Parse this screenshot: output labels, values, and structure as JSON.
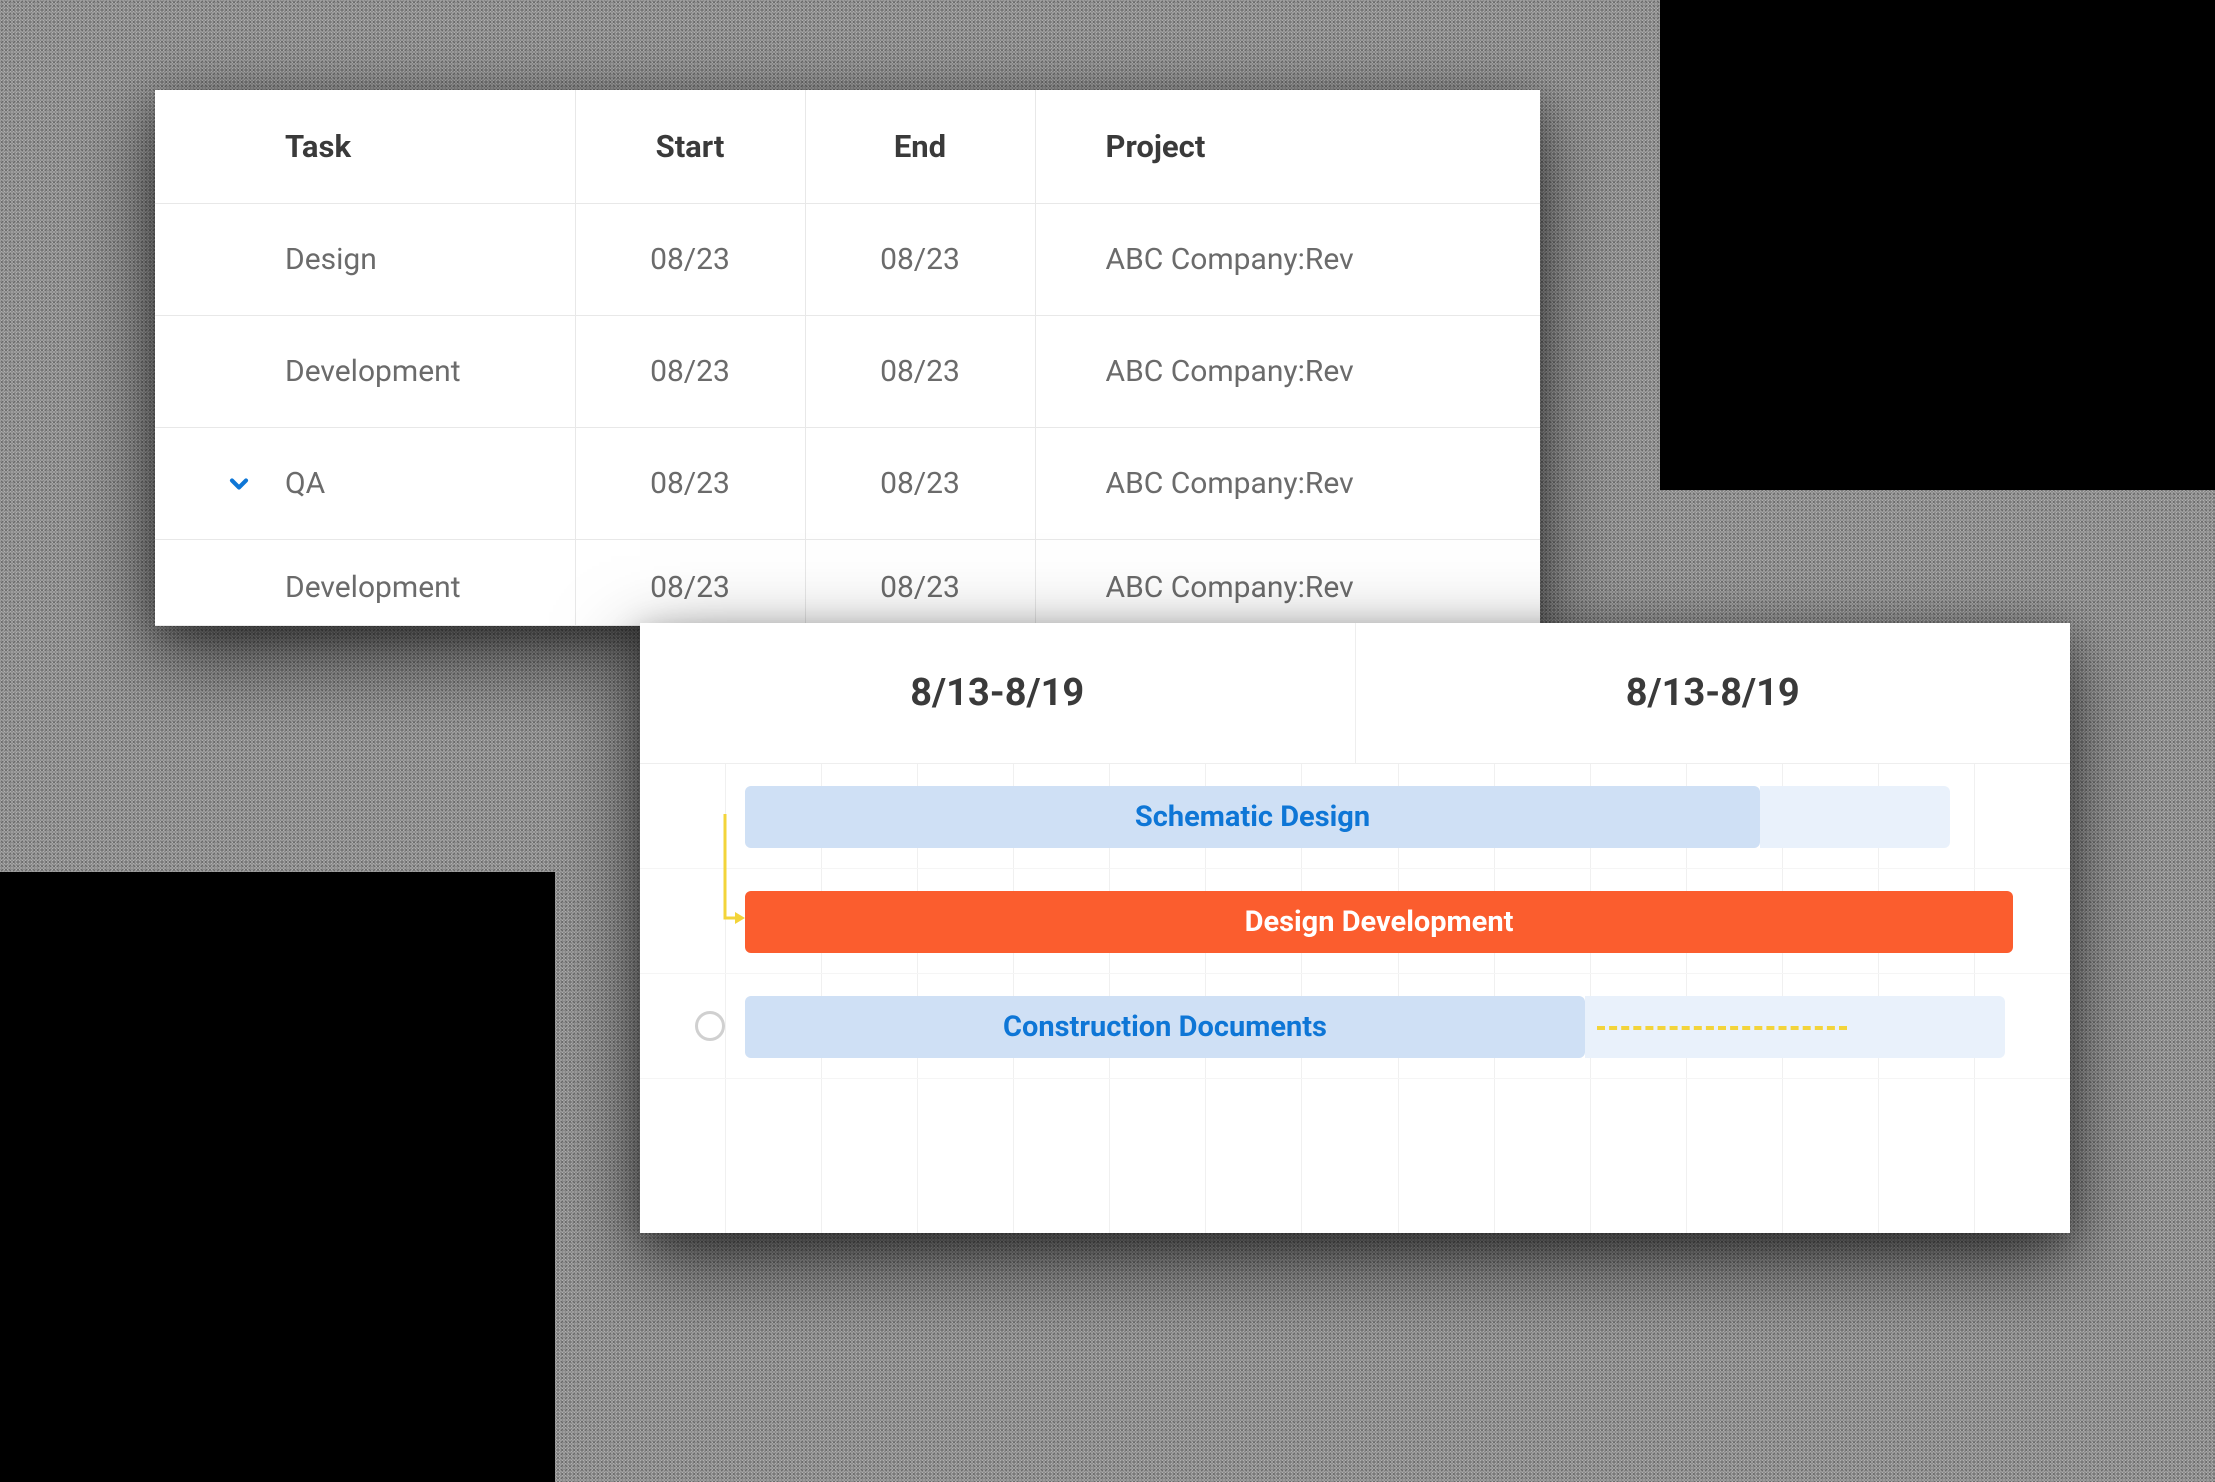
{
  "task_table": {
    "headers": {
      "task": "Task",
      "start": "Start",
      "end": "End",
      "project": "Project"
    },
    "rows": [
      {
        "task": "Design",
        "start": "08/23",
        "end": "08/23",
        "project": "ABC Company:Rev",
        "expandable": false
      },
      {
        "task": "Development",
        "start": "08/23",
        "end": "08/23",
        "project": "ABC Company:Rev",
        "expandable": false
      },
      {
        "task": "QA",
        "start": "08/23",
        "end": "08/23",
        "project": "ABC Company:Rev",
        "expandable": true
      },
      {
        "task": "Development",
        "start": "08/23",
        "end": "08/23",
        "project": "ABC Company:Rev",
        "expandable": false
      }
    ]
  },
  "gantt": {
    "columns": [
      "8/13-8/19",
      "8/13-8/19"
    ],
    "bars": [
      {
        "label": "Schematic Design",
        "variant": "schematic"
      },
      {
        "label": "Design Development",
        "variant": "design-dev"
      },
      {
        "label": "Construction Documents",
        "variant": "construction"
      }
    ]
  }
}
